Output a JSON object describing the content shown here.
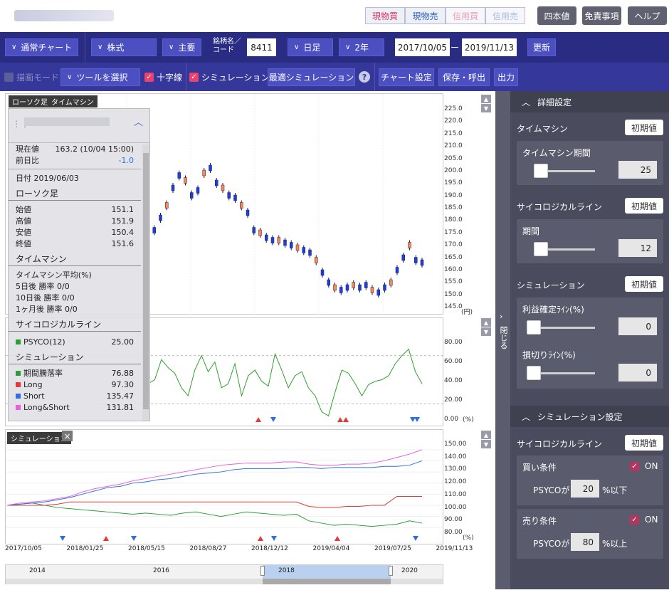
{
  "topbar": {
    "buttons": [
      "現物買",
      "現物売",
      "信用買",
      "信用売"
    ],
    "actions": [
      "四本値",
      "免責事項",
      "ヘルプ"
    ]
  },
  "nav1": {
    "chart_type": "通常チャート",
    "market": "株式",
    "exchange": "主要",
    "code_label": "銘柄名／コード",
    "code": "8411",
    "period": "日足",
    "range": "2年",
    "from": "2017/10/05",
    "dash": "ー",
    "to": "2019/11/13",
    "update": "更新"
  },
  "nav2": {
    "draw_mode": "描画モード",
    "tool": "ツールを選択",
    "crosshair": "十字線",
    "simulation": "シミュレーション",
    "optimal": "最適シミュレーション",
    "help": "?",
    "chart_settings": "チャート設定",
    "save": "保存・呼出",
    "output": "出力"
  },
  "panels": {
    "candle_tag": "ローソク足",
    "tm_tag": "タイムマシン",
    "sim_tag": "シミュレーション",
    "close": "×",
    "unit_yen": "(円)",
    "unit_pct": "(%)"
  },
  "price_ticks": [
    "225.0",
    "220.0",
    "215.0",
    "210.0",
    "205.0",
    "200.0",
    "195.0",
    "190.0",
    "185.0",
    "180.0",
    "175.0",
    "170.0",
    "165.0",
    "160.0",
    "155.0",
    "150.0",
    "145.0"
  ],
  "psy_ticks": [
    "80.00",
    "60.00",
    "40.00",
    "20.00",
    "0.00"
  ],
  "sim_ticks": [
    "150.00",
    "140.00",
    "130.00",
    "120.00",
    "110.00",
    "100.00",
    "90.00",
    "80.00"
  ],
  "date_ticks": [
    "2017/10/05",
    "2018/01/25",
    "2018/05/15",
    "2018/08/27",
    "2018/12/12",
    "2019/04/04",
    "2019/07/25",
    "2019/11/13"
  ],
  "nav_years": [
    "2014",
    "2016",
    "2018",
    "2020"
  ],
  "popup": {
    "current_label": "現在値",
    "current_value": "163.2 (10/04 15:00)",
    "change_label": "前日比",
    "change_value": "-1.0",
    "date": "日付  2019/06/03",
    "candle_title": "ローソク足",
    "ohlc": [
      {
        "k": "始値",
        "v": "151.1"
      },
      {
        "k": "高値",
        "v": "151.9"
      },
      {
        "k": "安値",
        "v": "150.4"
      },
      {
        "k": "終値",
        "v": "151.6"
      }
    ],
    "tm_title": "タイムマシン",
    "tm_rows": [
      "タイムマシン平均(%)",
      "5日後 勝率 0/0",
      "10日後 勝率 0/0",
      "1ヶ月後 勝率 0/0"
    ],
    "psy_title": "サイコロジカルライン",
    "psy_row": {
      "k": "PSYCO(12)",
      "v": "25.00"
    },
    "sim_title": "シミュレーション",
    "sim_rows": [
      {
        "k": "期間騰落率",
        "v": "76.88",
        "c": "#27a03a"
      },
      {
        "k": "Long",
        "v": "97.30",
        "c": "#e53935"
      },
      {
        "k": "Short",
        "v": "135.47",
        "c": "#2f6fe0"
      },
      {
        "k": "Long&Short",
        "v": "131.81",
        "c": "#e85fd8"
      }
    ]
  },
  "sidebar": {
    "detail": "詳細設定",
    "close": "閉じる",
    "tm": {
      "title": "タイムマシン",
      "reset": "初期値",
      "label": "タイムマシン期間",
      "value": "25"
    },
    "psy": {
      "title": "サイコロジカルライン",
      "reset": "初期値",
      "label": "期間",
      "value": "12"
    },
    "sim": {
      "title": "シミュレーション",
      "reset": "初期値",
      "tp_label": "利益確定ﾗｲﾝ(%)",
      "tp_value": "0",
      "sl_label": "損切りﾗｲﾝ(%)",
      "sl_value": "0"
    },
    "simset": "シミュレーション設定",
    "psy2": {
      "title": "サイコロジカルライン",
      "reset": "初期値",
      "buy_label": "買い条件",
      "buy_on": "ON",
      "buy_prefix": "PSYCOが",
      "buy_value": "20",
      "buy_suffix": "%以下",
      "sell_label": "売り条件",
      "sell_on": "ON",
      "sell_prefix": "PSYCOが",
      "sell_value": "80",
      "sell_suffix": "%以上"
    }
  },
  "chart_data": {
    "type": "line",
    "price": {
      "ylim": [
        145,
        225
      ],
      "values": [
        172,
        176,
        181,
        186,
        193,
        198,
        196,
        190,
        192,
        199,
        201,
        195,
        193,
        190,
        189,
        186,
        183,
        176,
        175,
        173,
        172,
        172,
        171,
        170,
        169,
        168,
        167,
        164,
        159,
        155,
        153,
        152,
        153,
        154,
        153,
        154,
        152,
        151,
        153,
        155,
        160,
        165,
        170,
        164,
        163
      ]
    },
    "psyco": {
      "ylim": [
        0,
        100
      ],
      "values": [
        45,
        50,
        75,
        65,
        58,
        40,
        30,
        62,
        80,
        60,
        72,
        40,
        45,
        70,
        30,
        55,
        62,
        48,
        42,
        82,
        62,
        40,
        55,
        60,
        40,
        30,
        10,
        5,
        35,
        62,
        58,
        45,
        30,
        44,
        48,
        50,
        55,
        70,
        80,
        88,
        60,
        45
      ]
    },
    "sim": {
      "ylim": [
        75,
        155
      ],
      "series": [
        {
          "color": "#27a03a",
          "values": [
            100,
            101,
            102,
            100,
            98,
            97,
            96,
            95,
            94,
            93,
            92,
            93,
            92,
            91,
            93,
            94,
            92,
            90,
            92,
            94,
            93,
            92,
            91,
            92,
            86,
            84,
            82,
            83,
            82,
            81,
            82,
            83,
            86,
            84
          ]
        },
        {
          "color": "#e53935",
          "values": [
            100,
            100,
            100,
            100,
            101,
            103,
            103,
            103,
            103,
            103,
            103,
            103,
            103,
            103,
            103,
            103,
            103,
            103,
            103,
            103,
            103,
            103,
            103,
            103,
            99,
            98,
            98,
            99,
            99,
            100,
            100,
            108,
            108,
            108
          ]
        },
        {
          "color": "#2f6fe0",
          "values": [
            100,
            101,
            102,
            103,
            105,
            107,
            110,
            113,
            116,
            117,
            120,
            121,
            123,
            124,
            126,
            128,
            129,
            130,
            132,
            133,
            133,
            133,
            133,
            134,
            134,
            133,
            134,
            134,
            134,
            134,
            135,
            135,
            136,
            140
          ]
        },
        {
          "color": "#e85fd8",
          "values": [
            100,
            102,
            103,
            104,
            106,
            108,
            112,
            115,
            117,
            119,
            122,
            124,
            126,
            128,
            130,
            132,
            134,
            136,
            137,
            138,
            138,
            138,
            139,
            139,
            137,
            136,
            136,
            137,
            137,
            138,
            140,
            143,
            146,
            150
          ]
        }
      ]
    }
  }
}
